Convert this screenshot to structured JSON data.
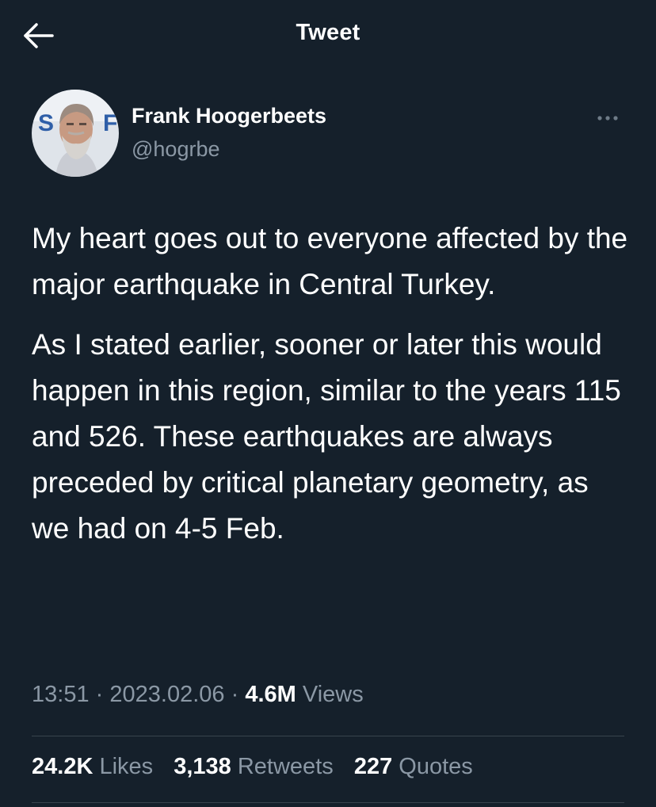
{
  "header": {
    "title": "Tweet"
  },
  "author": {
    "display_name": "Frank Hoogerbeets",
    "handle": "@hogrbe",
    "avatar_badge": "SSF"
  },
  "tweet": {
    "paragraphs": [
      "My heart goes out to everyone affected by the major earthquake in Central Turkey.",
      "As I stated earlier, sooner or later this would happen in this region, similar to the years 115 and 526. These earthquakes are always preceded by critical planetary geometry, as we had on 4-5 Feb."
    ],
    "time": "13:51",
    "date": "2023.02.06",
    "separator": "·",
    "views_count": "4.6M",
    "views_label": "Views"
  },
  "stats": {
    "likes_count": "24.2K",
    "likes_label": "Likes",
    "retweets_count": "3,138",
    "retweets_label": "Retweets",
    "quotes_count": "227",
    "quotes_label": "Quotes"
  },
  "colors": {
    "background": "#15202b",
    "primary_text": "#ffffff",
    "secondary_text": "#8b98a5",
    "divider": "#38444d"
  },
  "icons": {
    "back": "back-arrow-icon",
    "more": "more-options-icon"
  }
}
